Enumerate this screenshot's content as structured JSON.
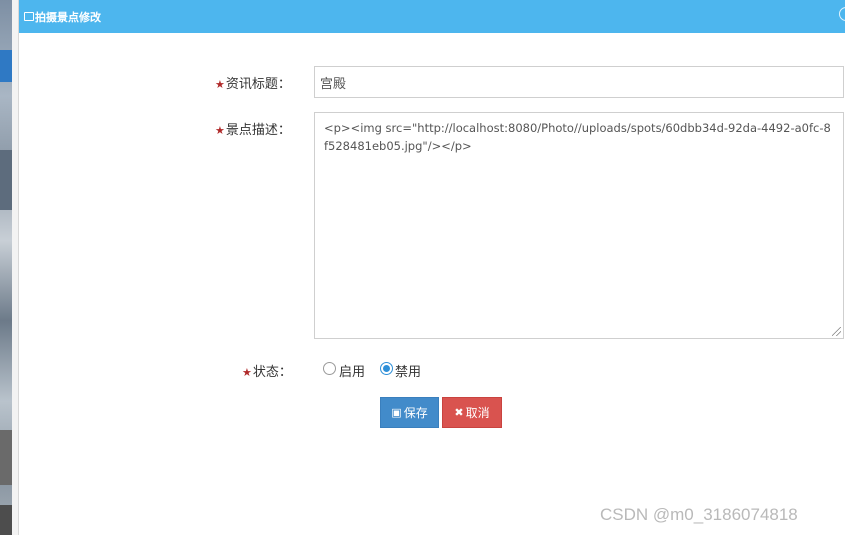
{
  "dialog": {
    "title": "拍摄景点修改"
  },
  "form": {
    "title_label": "资讯标题：",
    "title_value": "宫殿",
    "desc_label": "景点描述：",
    "desc_value": "<p><img src=\"http://localhost:8080/Photo//uploads/spots/60dbb34d-92da-4492-a0fc-8f528481eb05.jpg\"/></p>",
    "status_label": "状态：",
    "status_options": [
      {
        "label": "启用",
        "selected": false
      },
      {
        "label": "禁用",
        "selected": true
      }
    ],
    "required_mark": "★"
  },
  "buttons": {
    "save_label": "保存",
    "cancel_label": "取消"
  },
  "icons": {
    "title": "window-icon",
    "close": "close-icon",
    "save": "save-icon",
    "cancel": "times-icon"
  },
  "colors": {
    "titlebar": "#4db6ee",
    "save": "#428bca",
    "cancel": "#d9534f",
    "required": "#b02a2a"
  },
  "watermark": "CSDN @m0_3186074818"
}
